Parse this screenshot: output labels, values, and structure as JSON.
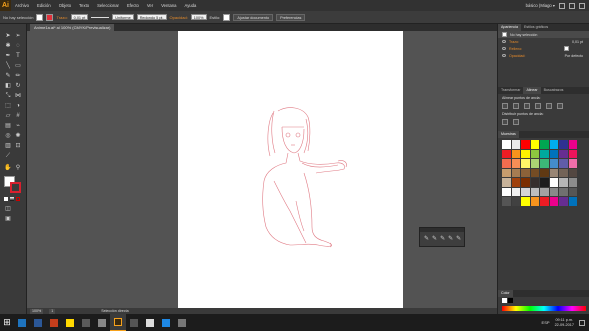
{
  "menubar": {
    "logo": "Ai",
    "items": [
      "Archivo",
      "Edición",
      "Objeto",
      "Texto",
      "Seleccionar",
      "Efecto",
      "Ver",
      "Ventana",
      "Ayuda"
    ],
    "workspace": "básico (Miago ▾"
  },
  "controlbar": {
    "selection_status": "No hay selección",
    "stroke_label": "Trazo:",
    "stroke_weight": "0,01 pt",
    "stroke_profile": "Uniforme",
    "brush_name": "Redondo 5 pt.",
    "opacity_label": "Opacidad:",
    "opacity_value": "100%",
    "style_label": "Estilo:",
    "doc_setup_btn": "Ajustar documento",
    "prefs_btn": "Preferencias",
    "fill_color": "#ffffff",
    "stroke_color": "#e0303a"
  },
  "document": {
    "tab_title": "Anime1a.ai* al 100% (CMYK/Previsualizar)"
  },
  "status": {
    "zoom": "100%",
    "page": "1",
    "tool_name": "Selección directa"
  },
  "panels": {
    "appearance_tabs": [
      "Apariencia",
      "Estilos gráficos"
    ],
    "appearance_title": "No hay selección",
    "appearance_rows": [
      {
        "label": "Trazo:",
        "value": "0,01 pt"
      },
      {
        "label": "Relleno:",
        "value": ""
      },
      {
        "label": "Opacidad:",
        "value": "Por defecto"
      }
    ],
    "align_tabs": [
      "Transformar",
      "Alinear",
      "Buscatrazos"
    ],
    "align_section1": "Alinear puntos de ancla:",
    "align_section2": "Distribuir puntos de ancla:",
    "swatches_tab": "Muestras",
    "color_tab": "Color"
  },
  "swatches": [
    "#ffffff",
    "#e8e8e8",
    "#ff0000",
    "#ffff00",
    "#00a651",
    "#00aeef",
    "#2e3192",
    "#ec008c",
    "#ed1c24",
    "#f7941d",
    "#fff200",
    "#8dc63f",
    "#00a99d",
    "#0072bc",
    "#662d91",
    "#ed145b",
    "#f26c4f",
    "#f68e56",
    "#fff568",
    "#acd373",
    "#3cb878",
    "#448ccb",
    "#605ca8",
    "#f06eaa",
    "#c69c6d",
    "#a67c52",
    "#8c6239",
    "#754c24",
    "#603913",
    "#998675",
    "#736357",
    "#534741",
    "#c7b299",
    "#a0410d",
    "#7b2e00",
    "#362f2d",
    "#1c1c1c",
    "#ffffff",
    "#b6b6b6",
    "#8c8c8c",
    "#ffffff",
    "#f0f0f0",
    "#d6d6d6",
    "#bdbdbd",
    "#a3a3a3",
    "#898989",
    "#707070",
    "#565656",
    "#555555",
    "#414141",
    "#ffff00",
    "#f7941d",
    "#ed1c24",
    "#ec008c",
    "#662d91",
    "#0072bc"
  ],
  "taskbar": {
    "language": "ESP",
    "time": "09:11 p.m.",
    "date": "22-09-2017"
  }
}
